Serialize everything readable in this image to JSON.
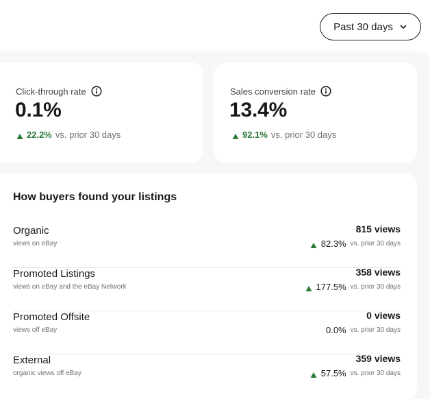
{
  "date_range": {
    "label": "Past 30 days",
    "icon": "chevron-down-icon"
  },
  "metrics": [
    {
      "label": "Click-through rate",
      "value": "0.1%",
      "change": "22.2%",
      "comparison": "vs. prior 30 days",
      "trend": "up"
    },
    {
      "label": "Sales conversion rate",
      "value": "13.4%",
      "change": "92.1%",
      "comparison": "vs. prior 30 days",
      "trend": "up"
    }
  ],
  "traffic": {
    "title": "How buyers found your listings",
    "sources": [
      {
        "name": "Organic",
        "description": "views on eBay",
        "views": "815 views",
        "change": "82.3%",
        "comparison": "vs. prior 30 days",
        "trend": "up"
      },
      {
        "name": "Promoted Listings",
        "description": "views on eBay and the eBay Network",
        "views": "358 views",
        "change": "177.5%",
        "comparison": "vs. prior 30 days",
        "trend": "up"
      },
      {
        "name": "Promoted Offsite",
        "description": "views off eBay",
        "views": "0 views",
        "change": "0.0%",
        "comparison": "vs. prior 30 days",
        "trend": "none"
      },
      {
        "name": "External",
        "description": "organic views off eBay",
        "views": "359 views",
        "change": "57.5%",
        "comparison": "vs. prior 30 days",
        "trend": "up"
      }
    ]
  },
  "colors": {
    "positive": "#2b7a3a",
    "background": "#f7f7f7",
    "card": "#ffffff",
    "text": "#191919",
    "muted": "#707070"
  }
}
